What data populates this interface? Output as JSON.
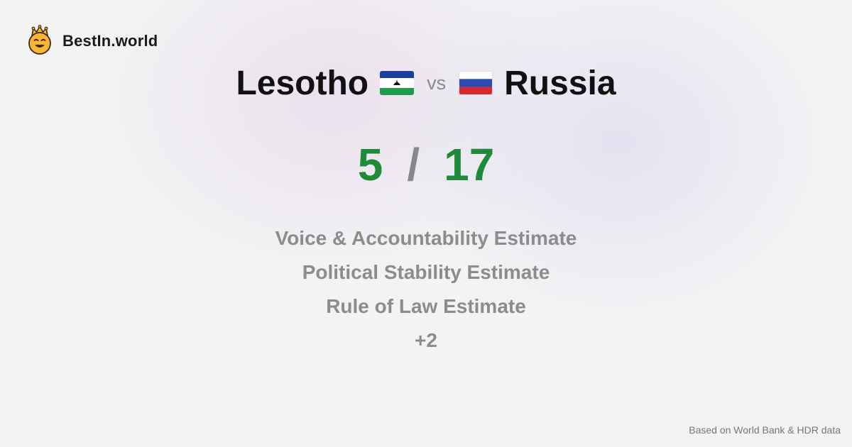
{
  "brand": {
    "name": "BestIn.world",
    "logo_icon": "crowned-smiley-icon"
  },
  "comparison": {
    "left_country": "Lesotho",
    "left_flag_icon": "lesotho-flag-icon",
    "vs_label": "vs",
    "right_country": "Russia",
    "right_flag_icon": "russia-flag-icon"
  },
  "score": {
    "left": "5",
    "separator": "/",
    "right": "17"
  },
  "metrics": [
    "Voice & Accountability Estimate",
    "Political Stability Estimate",
    "Rule of Law Estimate",
    "+2"
  ],
  "footer": {
    "source": "Based on World Bank & HDR data"
  },
  "colors": {
    "score_green": "#1e8a3a",
    "muted_gray": "#8c8c8c",
    "title_black": "#111111"
  }
}
